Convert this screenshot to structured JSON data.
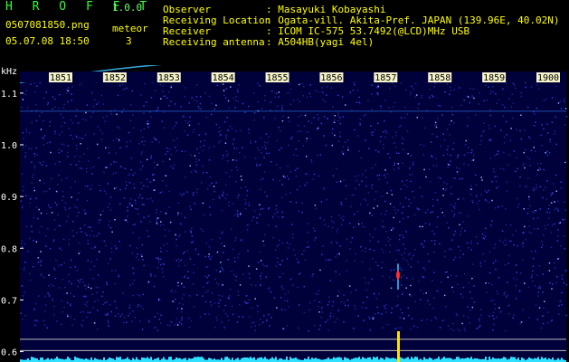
{
  "header": {
    "app_title": "H R O F F T",
    "app_version": "1.0.0",
    "filename": "0507081850.png",
    "datetime": "05.07.08 18:50",
    "count_label": "meteor",
    "count_value": "3",
    "fields": [
      {
        "label": "Observer",
        "value": ": Masayuki Kobayashi"
      },
      {
        "label": "Receiving Location",
        "value": ": Ogata-vill. Akita-Pref. JAPAN (139.96E, 40.02N)"
      },
      {
        "label": "Receiver",
        "value": ": ICOM IC-575 53.7492(@LCD)MHz USB"
      },
      {
        "label": "Receiving antenna",
        "value": ": A504HB(yagi 4el)"
      }
    ]
  },
  "spectrogram": {
    "y_unit": "kHz",
    "y_ticks": [
      1.1,
      1.0,
      0.9,
      0.8,
      0.7,
      0.6
    ],
    "y_range": [
      0.58,
      1.14
    ],
    "time_ticks": [
      "1851",
      "1852",
      "1853",
      "1854",
      "1855",
      "1856",
      "1857",
      "1858",
      "1859",
      "1900"
    ],
    "background_color": "#00003a",
    "noise_color": "#2a3cd0",
    "meteor_color": "#ff3030",
    "trace_color": "#3ec8ff",
    "activity_color": "#30e0ff",
    "spike_color": "#ffe000"
  }
}
